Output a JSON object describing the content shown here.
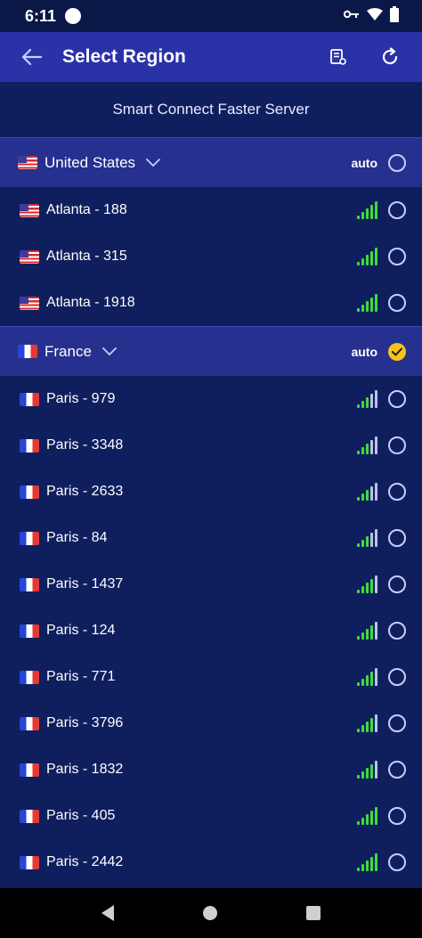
{
  "status_bar": {
    "time": "6:11"
  },
  "app_bar": {
    "title": "Select Region"
  },
  "smart_connect": {
    "label": "Smart Connect Faster Server"
  },
  "countries": [
    {
      "name": "United States",
      "flag": "us",
      "auto_label": "auto",
      "selected": false,
      "servers": [
        {
          "name": "Atlanta - 188",
          "signal": 5
        },
        {
          "name": "Atlanta - 315",
          "signal": 5
        },
        {
          "name": "Atlanta - 1918",
          "signal": 5
        }
      ]
    },
    {
      "name": "France",
      "flag": "fr",
      "auto_label": "auto",
      "selected": true,
      "servers": [
        {
          "name": "Paris - 979",
          "signal": 3
        },
        {
          "name": "Paris - 3348",
          "signal": 3
        },
        {
          "name": "Paris - 2633",
          "signal": 3
        },
        {
          "name": "Paris - 84",
          "signal": 3
        },
        {
          "name": "Paris - 1437",
          "signal": 4
        },
        {
          "name": "Paris - 124",
          "signal": 4
        },
        {
          "name": "Paris - 771",
          "signal": 4
        },
        {
          "name": "Paris - 3796",
          "signal": 4
        },
        {
          "name": "Paris - 1832",
          "signal": 4
        },
        {
          "name": "Paris - 405",
          "signal": 5
        },
        {
          "name": "Paris - 2442",
          "signal": 5
        }
      ]
    }
  ],
  "colors": {
    "accent": "#2a32a8",
    "signal_active": "#3ddc3d",
    "selected": "#f7c21a"
  }
}
